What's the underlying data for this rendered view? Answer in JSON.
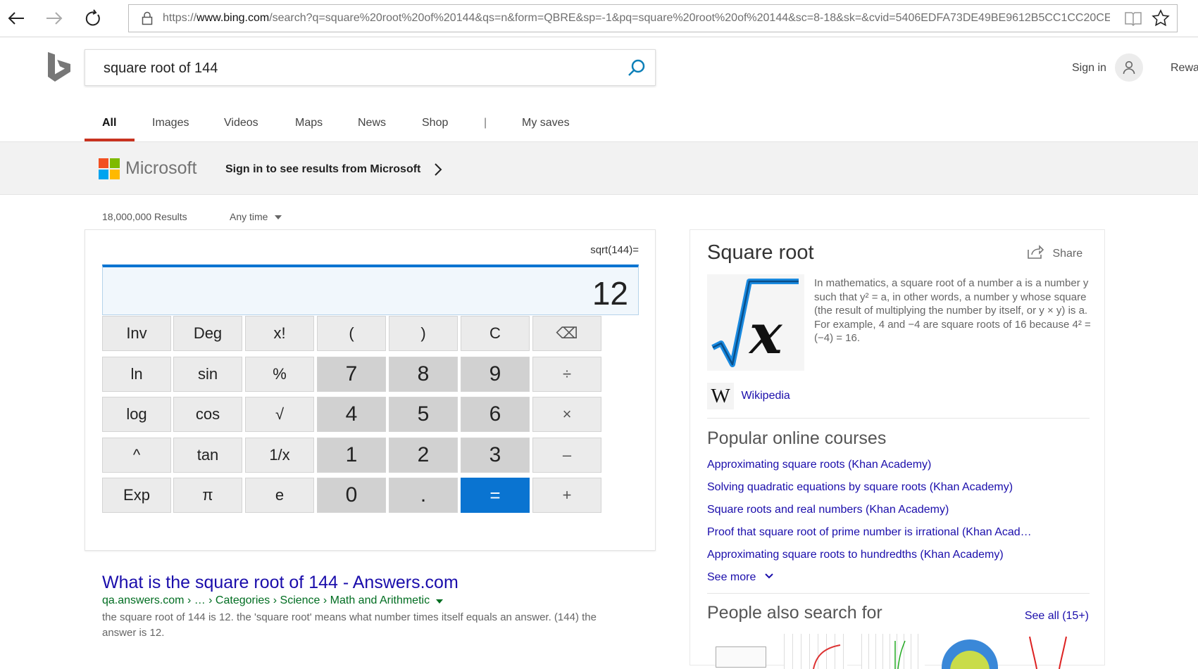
{
  "browser": {
    "url": "https://www.bing.com/search?q=square%20root%20of%20144&qs=n&form=QBRE&sp=-1&pq=square%20root%20of%20144&sc=8-18&sk=&cvid=5406EDFA73DE49BE9612B5CC1CC20CE"
  },
  "header": {
    "query": "square root of 144",
    "sign_in": "Sign in",
    "rewards": "Rewa"
  },
  "tabs": [
    "All",
    "Images",
    "Videos",
    "Maps",
    "News",
    "Shop",
    "|",
    "My saves"
  ],
  "banner": {
    "brand": "Microsoft",
    "text": "Sign in to see results from Microsoft"
  },
  "results_meta": {
    "count": "18,000,000 Results",
    "filter": "Any time"
  },
  "calculator": {
    "expression": "sqrt(144)=",
    "display": "12",
    "keys": [
      [
        "Inv",
        "Deg",
        "x!",
        "(",
        ")",
        "C",
        "⌫"
      ],
      [
        "ln",
        "sin",
        "%",
        "7",
        "8",
        "9",
        "÷"
      ],
      [
        "log",
        "cos",
        "√",
        "4",
        "5",
        "6",
        "×"
      ],
      [
        "^",
        "tan",
        "1/x",
        "1",
        "2",
        "3",
        "–"
      ],
      [
        "Exp",
        "π",
        "e",
        "0",
        ".",
        "=",
        "+"
      ]
    ]
  },
  "result1": {
    "title": "What is the square root of 144 - Answers.com",
    "url": "qa.answers.com › … › Categories › Science › Math and Arithmetic",
    "snippet": "the square root of 144 is 12. the 'square root' means what number times itself equals an answer. (144) the answer is 12."
  },
  "knowledge": {
    "title": "Square root",
    "share": "Share",
    "description": "In mathematics, a square root of a number a is a number y such that y² = a, in other words, a number y whose square (the result of multiplying the number by itself, or y × y) is a. For example, 4 and −4 are square roots of 16 because 4² = (−4) = 16.",
    "source": "Wikipedia",
    "courses_title": "Popular online courses",
    "courses": [
      "Approximating square roots (Khan Academy)",
      "Solving quadratic equations by square roots (Khan Academy)",
      "Square roots and real numbers (Khan Academy)",
      "Proof that square root of prime number is irrational (Khan Acad…",
      "Approximating square roots to hundredths (Khan Academy)"
    ],
    "see_more": "See more",
    "people_title": "People also search for",
    "see_all": "See all (15+)"
  },
  "colors": {
    "accent": "#0a74d1",
    "tab_underline": "#c8321f",
    "link": "#1a0dab",
    "url_green": "#006d21"
  }
}
